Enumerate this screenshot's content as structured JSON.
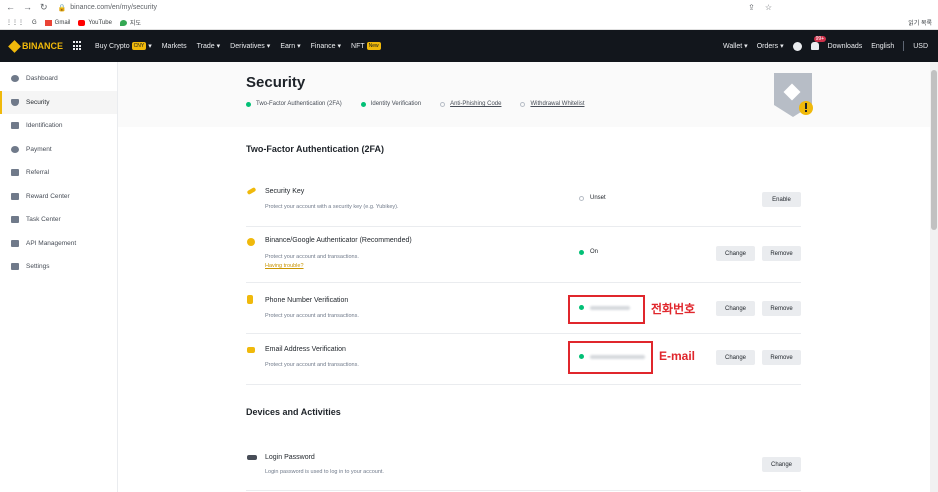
{
  "browser": {
    "url": "binance.com/en/my/security",
    "bookmarks": [
      "G",
      "Gmail",
      "YouTube",
      "지도"
    ],
    "bookmark_right": "읽기 목록"
  },
  "topnav": {
    "logo": "BINANCE",
    "items": [
      {
        "label": "Buy Crypto",
        "badge": "CNY"
      },
      {
        "label": "Markets"
      },
      {
        "label": "Trade"
      },
      {
        "label": "Derivatives"
      },
      {
        "label": "Earn"
      },
      {
        "label": "Finance"
      },
      {
        "label": "NFT",
        "badge": "New"
      }
    ],
    "right": {
      "wallet": "Wallet",
      "orders": "Orders",
      "notif_badge": "99+",
      "downloads": "Downloads",
      "language": "English",
      "currency": "USD"
    }
  },
  "sidebar": {
    "items": [
      {
        "label": "Dashboard"
      },
      {
        "label": "Security"
      },
      {
        "label": "Identification"
      },
      {
        "label": "Payment"
      },
      {
        "label": "Referral"
      },
      {
        "label": "Reward Center"
      },
      {
        "label": "Task Center"
      },
      {
        "label": "API Management"
      },
      {
        "label": "Settings"
      }
    ]
  },
  "hero": {
    "title": "Security",
    "checks": [
      "Two-Factor Authentication (2FA)",
      "Identity Verification",
      "Anti-Phishing Code",
      "Withdrawal Whitelist"
    ]
  },
  "twofa": {
    "title": "Two-Factor Authentication (2FA)",
    "rows": [
      {
        "title": "Security Key",
        "desc": "Protect your account with a security key (e.g. Yubikey).",
        "status": "Unset",
        "btn1": "Enable"
      },
      {
        "title": "Binance/Google Authenticator (Recommended)",
        "desc": "Protect your account and transactions.",
        "link": "Having trouble?",
        "status": "On",
        "btn1": "Change",
        "btn2": "Remove"
      },
      {
        "title": "Phone Number Verification",
        "desc": "Protect your account and transactions.",
        "btn1": "Change",
        "btn2": "Remove",
        "annotation": "전화번호"
      },
      {
        "title": "Email Address Verification",
        "desc": "Protect your account and transactions.",
        "btn1": "Change",
        "btn2": "Remove",
        "annotation": "E-mail"
      }
    ]
  },
  "devices": {
    "title": "Devices and Activities",
    "rows": [
      {
        "title": "Login Password",
        "desc": "Login password is used to log in to your account.",
        "btn1": "Change"
      }
    ]
  }
}
